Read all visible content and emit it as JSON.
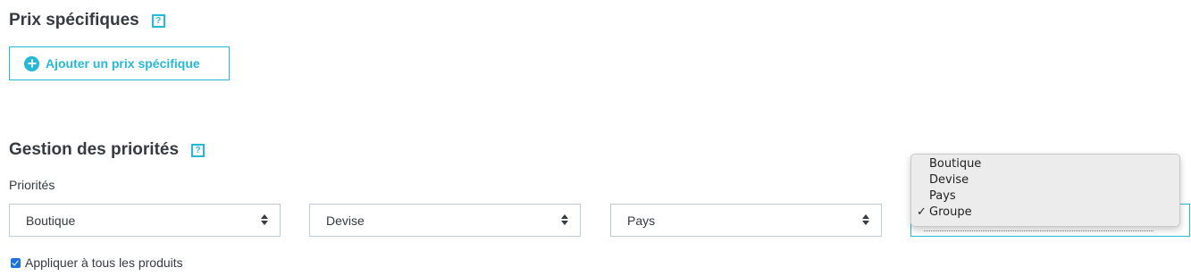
{
  "specific_prices": {
    "title": "Prix spécifiques",
    "help": "?",
    "add_button_label": "Ajouter un prix spécifique"
  },
  "priorities": {
    "title": "Gestion des priorités",
    "help": "?",
    "label": "Priorités",
    "selects": [
      {
        "value": "Boutique"
      },
      {
        "value": "Devise"
      },
      {
        "value": "Pays"
      },
      {
        "value": "Groupe"
      }
    ],
    "dropdown_options": [
      "Boutique",
      "Devise",
      "Pays",
      "Groupe"
    ],
    "dropdown_checkmark": "✓",
    "apply_all_label": "Appliquer à tous les produits",
    "apply_all_checked": true
  },
  "colors": {
    "accent": "#25b9d7",
    "text": "#363a41",
    "border": "#bbcdd2"
  }
}
